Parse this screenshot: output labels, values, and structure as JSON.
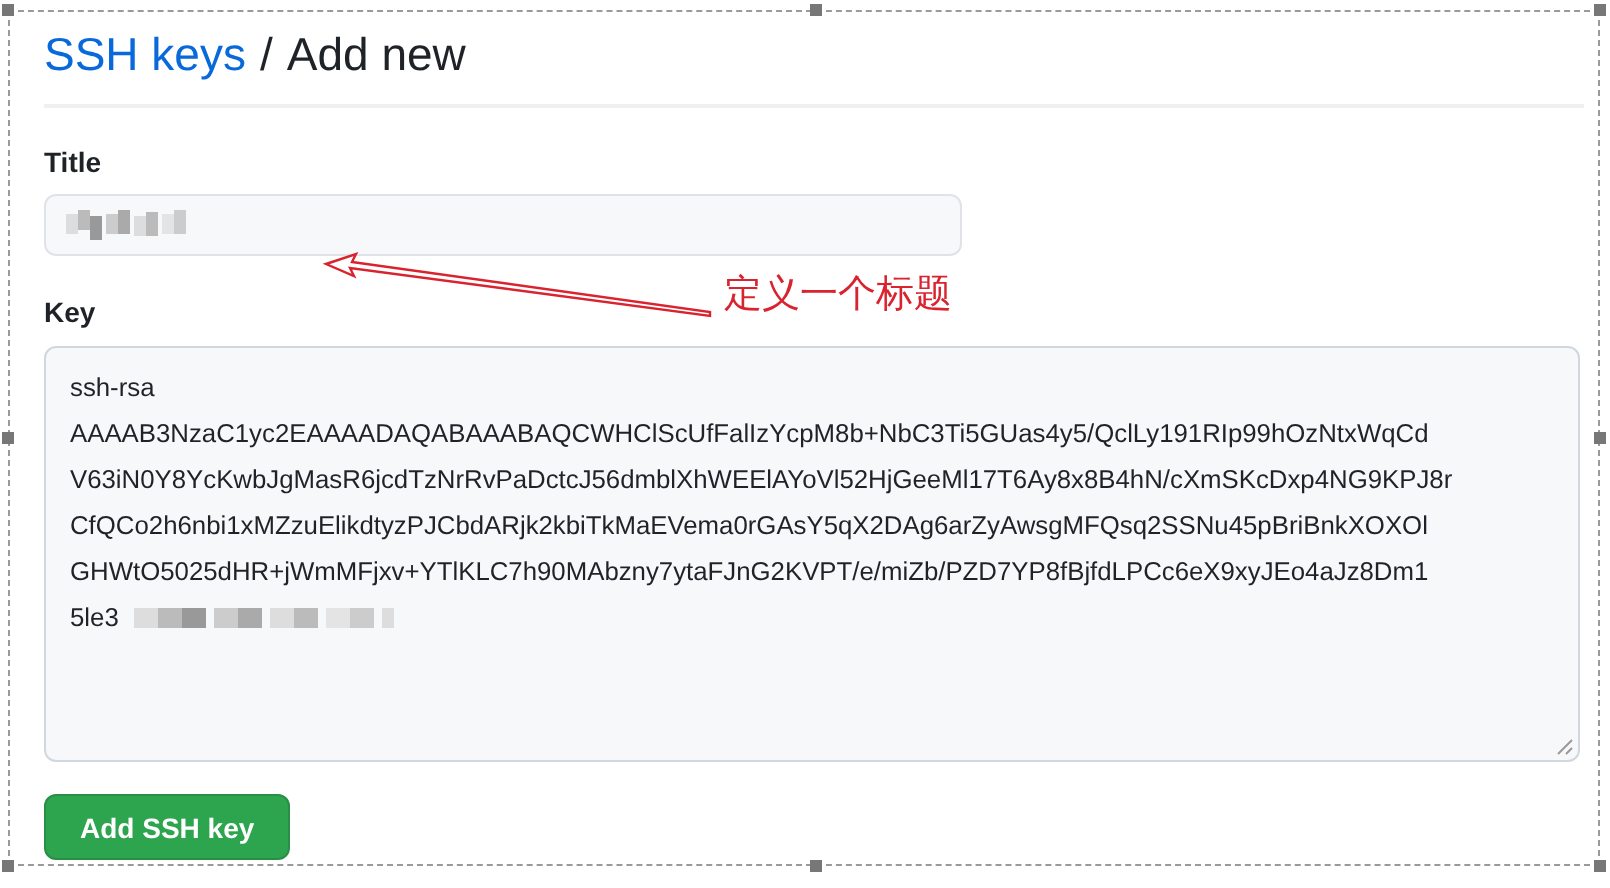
{
  "header": {
    "link": "SSH keys",
    "separator": "/",
    "title": "Add new"
  },
  "title_field": {
    "label": "Title",
    "redacted": true
  },
  "annotation": {
    "text": "定义一个标题"
  },
  "key_field": {
    "label": "Key",
    "lines": [
      "ssh-rsa",
      "AAAAB3NzaC1yc2EAAAADAQABAAABAQCWHClScUfFalIzYcpM8b+NbC3Ti5GUas4y5/QclLy191RIp99hOzNtxWqCd",
      "V63iN0Y8YcKwbJgMasR6jcdTzNrRvPaDctcJ56dmblXhWEElAYoVl52HjGeeMl17T6Ay8x8B4hN/cXmSKcDxp4NG9KPJ8r",
      "CfQCo2h6nbi1xMZzuElikdtyzPJCbdARjk2kbiTkMaEVema0rGAsY5qX2DAg6arZyAwsgMFQsq2SSNu45pBriBnkXOXOl",
      "GHWtO5025dHR+jWmMFjxv+YTlKLC7h90MAbzny7ytaFJnG2KVPT/e/miZb/PZD7YP8fBjfdLPCc6eX9xyJEo4aJz8Dm1",
      "5le3"
    ],
    "redacted_tail": true
  },
  "button": {
    "label": "Add SSH key"
  }
}
